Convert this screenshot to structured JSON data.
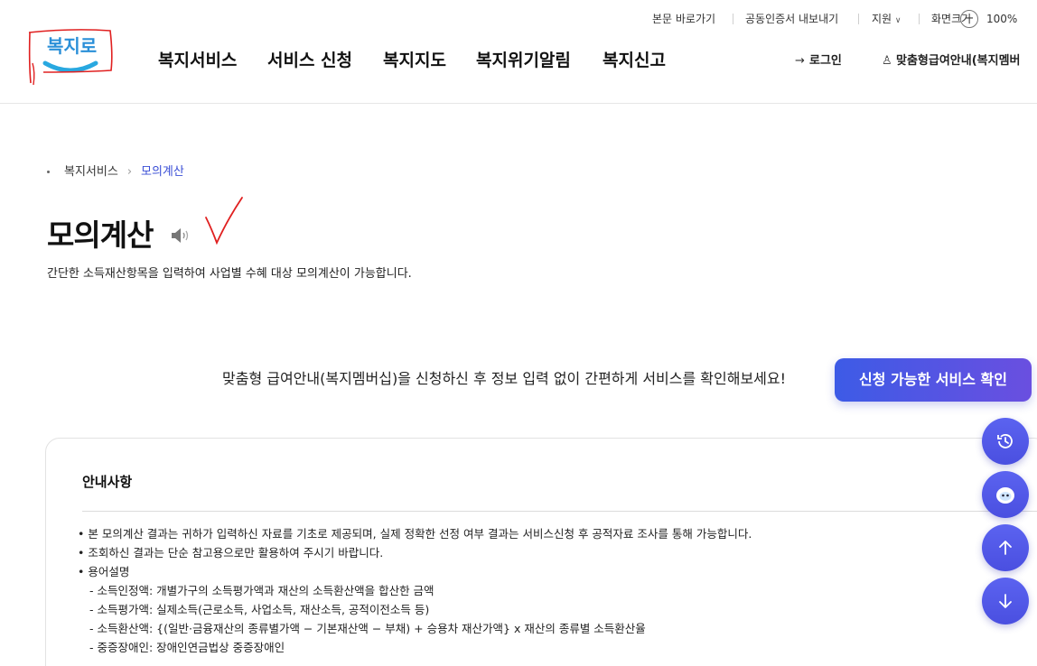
{
  "utility": {
    "skip_to_content": "본문 바로가기",
    "cert_export": "공동인증서 내보내기",
    "support": "지원",
    "screen_size": "화면크기",
    "zoom_minus": "−",
    "zoom_level": "100%"
  },
  "logo": {
    "text": "복지로"
  },
  "gnb": {
    "items": [
      "복지서비스",
      "서비스 신청",
      "복지지도",
      "복지위기알림",
      "복지신고"
    ]
  },
  "header_right": {
    "login": "로그인",
    "membership": "맞춤형급여안내(복지멤버"
  },
  "breadcrumb": {
    "parent": "복지서비스",
    "current": "모의계산"
  },
  "page": {
    "title": "모의계산",
    "description": "간단한 소득재산항목을 입력하여 사업별 수혜 대상 모의계산이 가능합니다."
  },
  "promo": {
    "text": "맞춤형 급여안내(복지멤버십)을 신청하신 후 정보 입력 없이 간편하게 서비스를 확인해보세요!",
    "button": "신청 가능한 서비스 확인"
  },
  "notice": {
    "title": "안내사항",
    "items": [
      "• 본 모의계산 결과는 귀하가 입력하신 자료를 기초로 제공되며, 실제 정확한 선정 여부 결과는 서비스신청 후 공적자료 조사를 통해 가능합니다.",
      "• 조회하신 결과는 단순 참고용으로만 활용하여 주시기 바랍니다.",
      "• 용어설명"
    ],
    "terms": [
      "- 소득인정액: 개별가구의 소득평가액과 재산의 소득환산액을 합산한 금액",
      "- 소득평가액: 실제소득(근로소득, 사업소득, 재산소득, 공적이전소득 등)",
      "- 소득환산액: {(일반·금융재산의 종류별가액 − 기본재산액 − 부채) + 승용차 재산가액} x 재산의 종류별 소득환산율",
      "- 중증장애인: 장애인연금법상 중증장애인"
    ]
  },
  "colors": {
    "accent": "#3b4fd6",
    "button_gradient_start": "#3d5be6",
    "button_gradient_end": "#6a4fe0",
    "annotation_red": "#e02020"
  },
  "icons": [
    "speaker-icon",
    "login-icon",
    "person-add-icon",
    "history-icon",
    "chatbot-icon",
    "arrow-up-icon",
    "arrow-down-icon",
    "chevron-down-icon"
  ]
}
